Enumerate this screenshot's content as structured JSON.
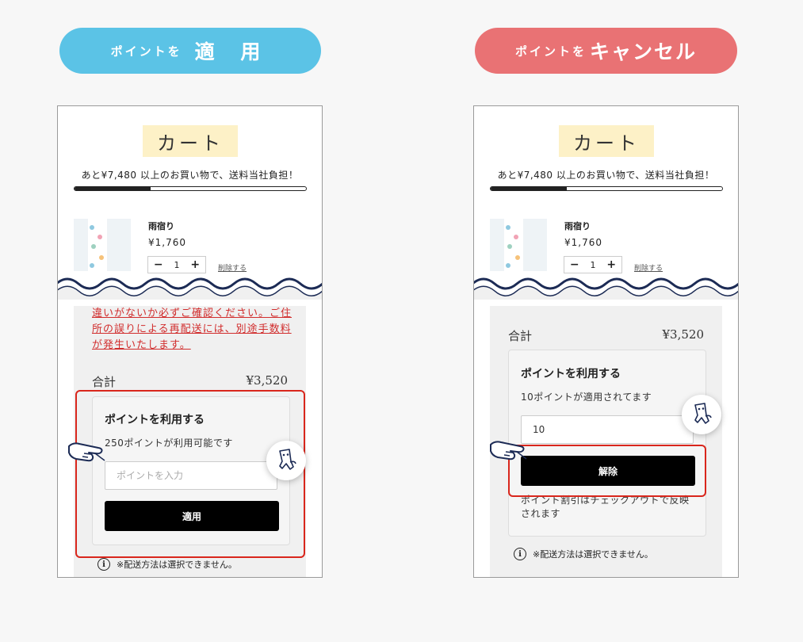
{
  "headers": {
    "apply": {
      "prefix": "ポイントを",
      "main": "適 用"
    },
    "cancel": {
      "prefix": "ポイントを",
      "main": "キャンセル"
    }
  },
  "cart": {
    "title": "カート",
    "shipping_message": "あと¥7,480 以上のお買い物で、送料当社負担！",
    "shipping_progress": 0.33,
    "item": {
      "name": "雨宿り",
      "price": "¥1,760",
      "quantity": "1",
      "minus": "−",
      "plus": "+",
      "delete_label": "削除する"
    }
  },
  "left_panel": {
    "warning": "違いがないか必ずご確認ください。ご住所の誤りによる再配送には、別途手数料が発生いたします。",
    "total_label": "合計",
    "total_value": "¥3,520",
    "points_title": "ポイントを利用する",
    "points_available": "250ポイントが利用可能です",
    "points_placeholder": "ポイントを入力",
    "apply_button": "適用",
    "shipping_note": "※配送方法は選択できません。"
  },
  "right_panel": {
    "total_label": "合計",
    "total_value": "¥3,520",
    "points_title": "ポイントを利用する",
    "points_applied": "10ポイントが適用されてます",
    "points_value": "10",
    "release_button": "解除",
    "discount_note": "ポイント割引はチェックアウトで反映されます",
    "shipping_note": "※配送方法は選択できません。"
  },
  "colors": {
    "apply_pill": "#5bc3e6",
    "cancel_pill": "#e97274",
    "highlight": "#d9261c",
    "wave": "#1c2b55"
  },
  "icons": [
    "pointing-hand-icon",
    "mascot-icon",
    "info-icon"
  ]
}
